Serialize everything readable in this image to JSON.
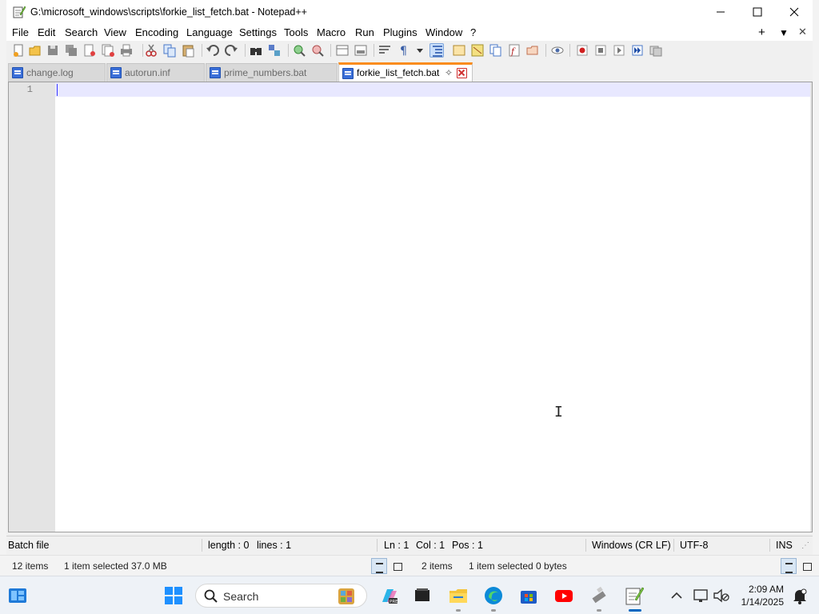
{
  "window": {
    "title": "G:\\microsoft_windows\\scripts\\forkie_list_fetch.bat - Notepad++",
    "app_icon": "notepadpp-icon",
    "controls": [
      "minimize-icon",
      "maximize-icon",
      "close-icon"
    ]
  },
  "menu": {
    "items": [
      "File",
      "Edit",
      "Search",
      "View",
      "Encoding",
      "Language",
      "Settings",
      "Tools",
      "Macro",
      "Run",
      "Plugins",
      "Window",
      "?"
    ],
    "right": [
      "+",
      "▼",
      "✕"
    ]
  },
  "tabs": [
    {
      "label": "change.log",
      "active": false
    },
    {
      "label": "autorun.inf",
      "active": false
    },
    {
      "label": "prime_numbers.bat",
      "active": false
    },
    {
      "label": "forkie_list_fetch.bat",
      "active": true
    }
  ],
  "editor": {
    "line_numbers": [
      "1"
    ],
    "content": ""
  },
  "status": {
    "file_type": "Batch file",
    "length": "length : 0",
    "lines": "lines : 1",
    "ln": "Ln : 1",
    "col": "Col : 1",
    "pos": "Pos : 1",
    "eol": "Windows (CR LF)",
    "encoding": "UTF-8",
    "mode": "INS"
  },
  "explorer_status": {
    "left_items": "12 items",
    "left_selected": "1 item selected  37.0 MB",
    "right_items": "2 items",
    "right_selected": "1 item selected  0 bytes"
  },
  "taskbar": {
    "search_label": "Search",
    "time": "2:09 AM",
    "date": "1/14/2025"
  },
  "colors": {
    "active_tab_accent": "#fa8c1e",
    "current_line": "#e8e8ff",
    "caret": "#3838ff"
  }
}
